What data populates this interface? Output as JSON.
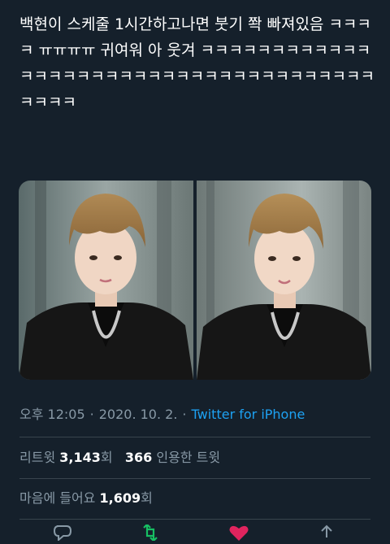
{
  "tweet": {
    "text": "백현이 스케줄 1시간하고나면 붓기 쫙 빠져있음 ㅋㅋㅋㅋ ㅠㅠㅠㅠ 귀여워 아 웃겨 ㅋㅋㅋㅋㅋㅋㅋㅋㅋㅋㅋㅋㅋㅋㅋㅋㅋㅋㅋㅋㅋㅋㅋㅋㅋㅋㅋㅋㅋㅋㅋㅋㅋㅋㅋㅋㅋㅋㅋㅋㅋ"
  },
  "meta": {
    "time": "오후 12:05",
    "separator": "·",
    "date": "2020. 10. 2.",
    "source": "Twitter for iPhone"
  },
  "stats": {
    "retweets_label": "리트윗",
    "retweets_count": "3,143",
    "retweets_suffix": "회",
    "quotes_count": "366",
    "quotes_label": "인용한 트윗",
    "likes_label": "마음에 들어요",
    "likes_count": "1,609",
    "likes_suffix": "회"
  },
  "colors": {
    "background": "#15202b",
    "text": "#ffffff",
    "secondary": "#8899a6",
    "link": "#1da1f2",
    "retweet": "#17bf63",
    "like": "#e0245e",
    "divider": "#38444d"
  },
  "media": {
    "photos": [
      {
        "name": "photo-left"
      },
      {
        "name": "photo-right"
      }
    ]
  },
  "actions": [
    {
      "icon": "reply-icon"
    },
    {
      "icon": "retweet-icon"
    },
    {
      "icon": "like-icon"
    },
    {
      "icon": "share-icon"
    }
  ]
}
